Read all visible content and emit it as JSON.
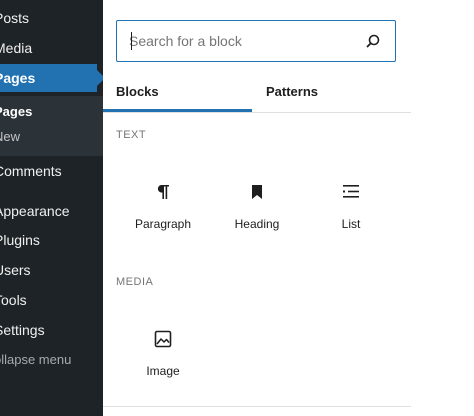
{
  "sidebar": {
    "items": [
      {
        "label": "Posts"
      },
      {
        "label": "Media"
      },
      {
        "label": "Pages"
      },
      {
        "label": "Comments"
      },
      {
        "label": "Appearance"
      },
      {
        "label": "Plugins"
      },
      {
        "label": "Users"
      },
      {
        "label": "Tools"
      },
      {
        "label": "Settings"
      }
    ],
    "submenu": [
      {
        "label": "Pages"
      },
      {
        "label": "New"
      }
    ],
    "collapse_label": "ollapse menu"
  },
  "inserter": {
    "search": {
      "placeholder": "Search for a block",
      "value": ""
    },
    "tabs": [
      {
        "label": "Blocks",
        "active": true
      },
      {
        "label": "Patterns",
        "active": false
      }
    ],
    "categories": [
      {
        "label": "TEXT",
        "blocks": [
          {
            "label": "Paragraph",
            "icon": "paragraph-icon"
          },
          {
            "label": "Heading",
            "icon": "bookmark-icon"
          },
          {
            "label": "List",
            "icon": "list-icon"
          }
        ]
      },
      {
        "label": "MEDIA",
        "blocks": [
          {
            "label": "Image",
            "icon": "image-icon"
          }
        ]
      }
    ]
  },
  "colors": {
    "accent": "#2271b1",
    "sidebar_bg": "#1d2327",
    "submenu_bg": "#2c3338"
  }
}
